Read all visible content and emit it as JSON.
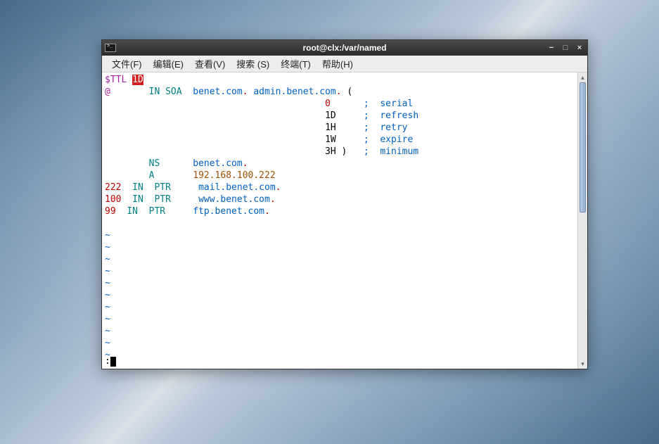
{
  "window": {
    "title": "root@clx:/var/named"
  },
  "menu": {
    "file": "文件(F)",
    "edit": "编辑(E)",
    "view": "查看(V)",
    "search": "搜索 (S)",
    "terminal": "终端(T)",
    "help": "帮助(H)"
  },
  "line1": {
    "ttl": "$TTL ",
    "ttl_val": "1D"
  },
  "line2": {
    "at": "@",
    "in": "IN",
    "soa": "SOA",
    "master": "benet.com",
    "dot1": ".",
    "admin": "admin.benet.com",
    "dot2": ".",
    "paren": " ("
  },
  "soa_serial": {
    "val": "0 ",
    "comment": ";  serial"
  },
  "soa_refresh": {
    "val": "1D",
    "comment": ";  refresh"
  },
  "soa_retry": {
    "val": "1H",
    "comment": ";  retry"
  },
  "soa_expire": {
    "val": "1W",
    "comment": ";  expire"
  },
  "soa_minimum": {
    "val": "3H",
    "paren": " )   ",
    "comment": ";  minimum"
  },
  "ns": {
    "type": "NS",
    "val": "benet.com",
    "dot": "."
  },
  "a": {
    "type": "A",
    "val": "192.168.100.222"
  },
  "ptr1": {
    "num": "222",
    "in": "IN",
    "type": "PTR",
    "val": "mail.benet.com",
    "dot": "."
  },
  "ptr2": {
    "num": "100",
    "in": "IN",
    "type": "PTR",
    "val": "www.benet.com",
    "dot": "."
  },
  "ptr3": {
    "num": "99 ",
    "in": "IN",
    "type": "PTR",
    "val": "ftp.benet.com",
    "dot": "."
  },
  "tilde": "~",
  "status_prompt": ":"
}
